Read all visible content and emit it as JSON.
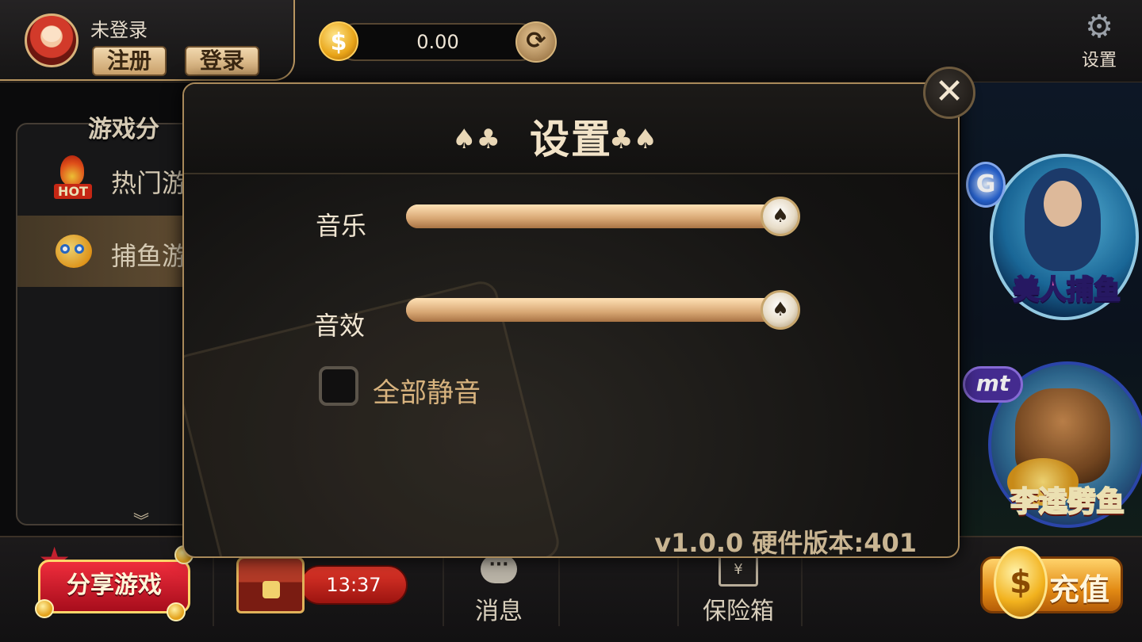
{
  "top": {
    "username": "未登录",
    "register_label": "注册",
    "login_label": "登录",
    "coin_symbol": "$",
    "balance": "0.00",
    "settings_label": "设置"
  },
  "categories": {
    "title": "游戏分",
    "hot_badge": "HOT",
    "items": [
      {
        "label": "热门游",
        "icon": "hot-flame-icon",
        "selected": false
      },
      {
        "label": "捕鱼游",
        "icon": "fish-icon",
        "selected": true
      }
    ],
    "more_icon": "chevron-double-down-icon"
  },
  "games": [
    {
      "title": "美人捕鱼",
      "badge": "G"
    },
    {
      "title": "李逵劈鱼",
      "badge": "mt"
    }
  ],
  "bottom": {
    "share_label": "分享游戏",
    "timer": "13:37",
    "message_label": "消息",
    "safe_label": "保险箱",
    "safe_glyph": "¥",
    "recharge_label": "充值",
    "recharge_coin_symbol": "$"
  },
  "dialog": {
    "title": "设置",
    "suit_left": "♠♣",
    "suit_right": "♣♠",
    "music_label": "音乐",
    "music_level": 1.0,
    "sfx_label": "音效",
    "sfx_level": 1.0,
    "knob_glyph": "♠",
    "mute_label": "全部静音",
    "mute_checked": false,
    "version": "v1.0.0  硬件版本:401",
    "close_glyph": "✕"
  },
  "colors": {
    "accent_gold": "#b89560",
    "slider": "#d7a673",
    "mute_text": "#d8b37e",
    "timer_red": "#e2372a"
  }
}
